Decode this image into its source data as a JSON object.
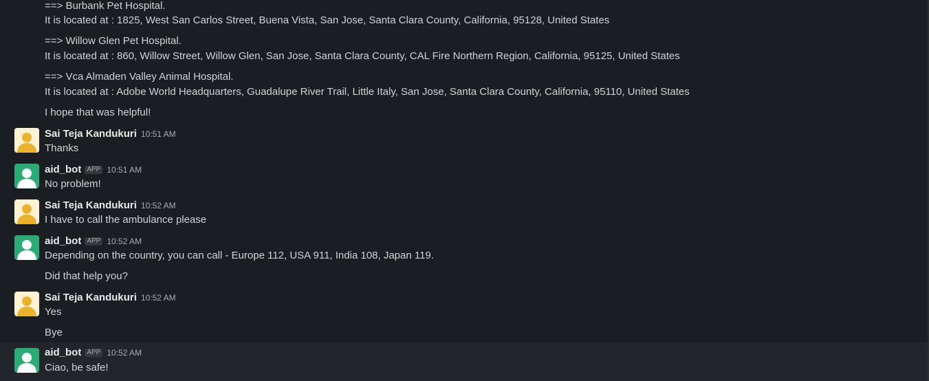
{
  "top_lines": [
    "==> Burbank Pet Hospital.",
    "It is located at : 1825, West San Carlos Street, Buena Vista, San Jose, Santa Clara County, California, 95128, United States",
    "==> Willow Glen Pet Hospital.",
    "It is located at : 860, Willow Street, Willow Glen, San Jose, Santa Clara County, CAL Fire Northern Region, California, 95125, United States",
    "==> Vca Almaden Valley Animal Hospital.",
    "It is located at : Adobe World Headquarters, Guadalupe River Trail, Little Italy, San Jose, Santa Clara County, California, 95110, United States",
    "I hope that was helpful!"
  ],
  "messages": [
    {
      "author": "Sai Teja Kandukuri",
      "time": "10:51 AM",
      "text": "Thanks"
    },
    {
      "author": "aid_bot",
      "badge": "APP",
      "time": "10:51 AM",
      "text": "No problem!"
    },
    {
      "author": "Sai Teja Kandukuri",
      "time": "10:52 AM",
      "text": "I have to call the ambulance please"
    },
    {
      "author": "aid_bot",
      "badge": "APP",
      "time": "10:52 AM",
      "text": "Depending on the country, you can call - Europe 112, USA 911, India 108, Japan 119.",
      "followup": "Did that help you?"
    },
    {
      "author": "Sai Teja Kandukuri",
      "time": "10:52 AM",
      "text": "Yes",
      "followup": "Bye"
    },
    {
      "author": "aid_bot",
      "badge": "APP",
      "time": "10:52 AM",
      "text": "Ciao, be safe!"
    }
  ],
  "colors": {
    "background": "#1a1d21",
    "user_avatar": "#ecb22e",
    "bot_avatar": "#2bac76"
  },
  "icons": {
    "user_avatar": "person-avatar-icon",
    "bot_avatar": "person-avatar-icon"
  }
}
